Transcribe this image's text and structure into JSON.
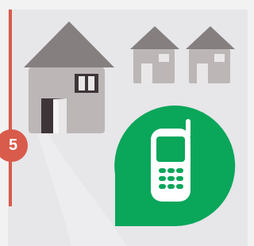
{
  "step": {
    "number": "5"
  },
  "colors": {
    "page_background": "#f2f2f2",
    "panel_background": "#e7e6e9",
    "timeline_accent": "#d95b4b",
    "house_roof": "#857f80",
    "house_wall": "#bcb6b6",
    "door_dark": "#3e3538",
    "phone_bubble": "#0aa65a",
    "phone_icon": "#ffffff"
  },
  "icons": {
    "main_house": "house-icon",
    "small_houses": [
      "house-icon",
      "house-icon"
    ],
    "phone": "mobile-phone-icon"
  }
}
